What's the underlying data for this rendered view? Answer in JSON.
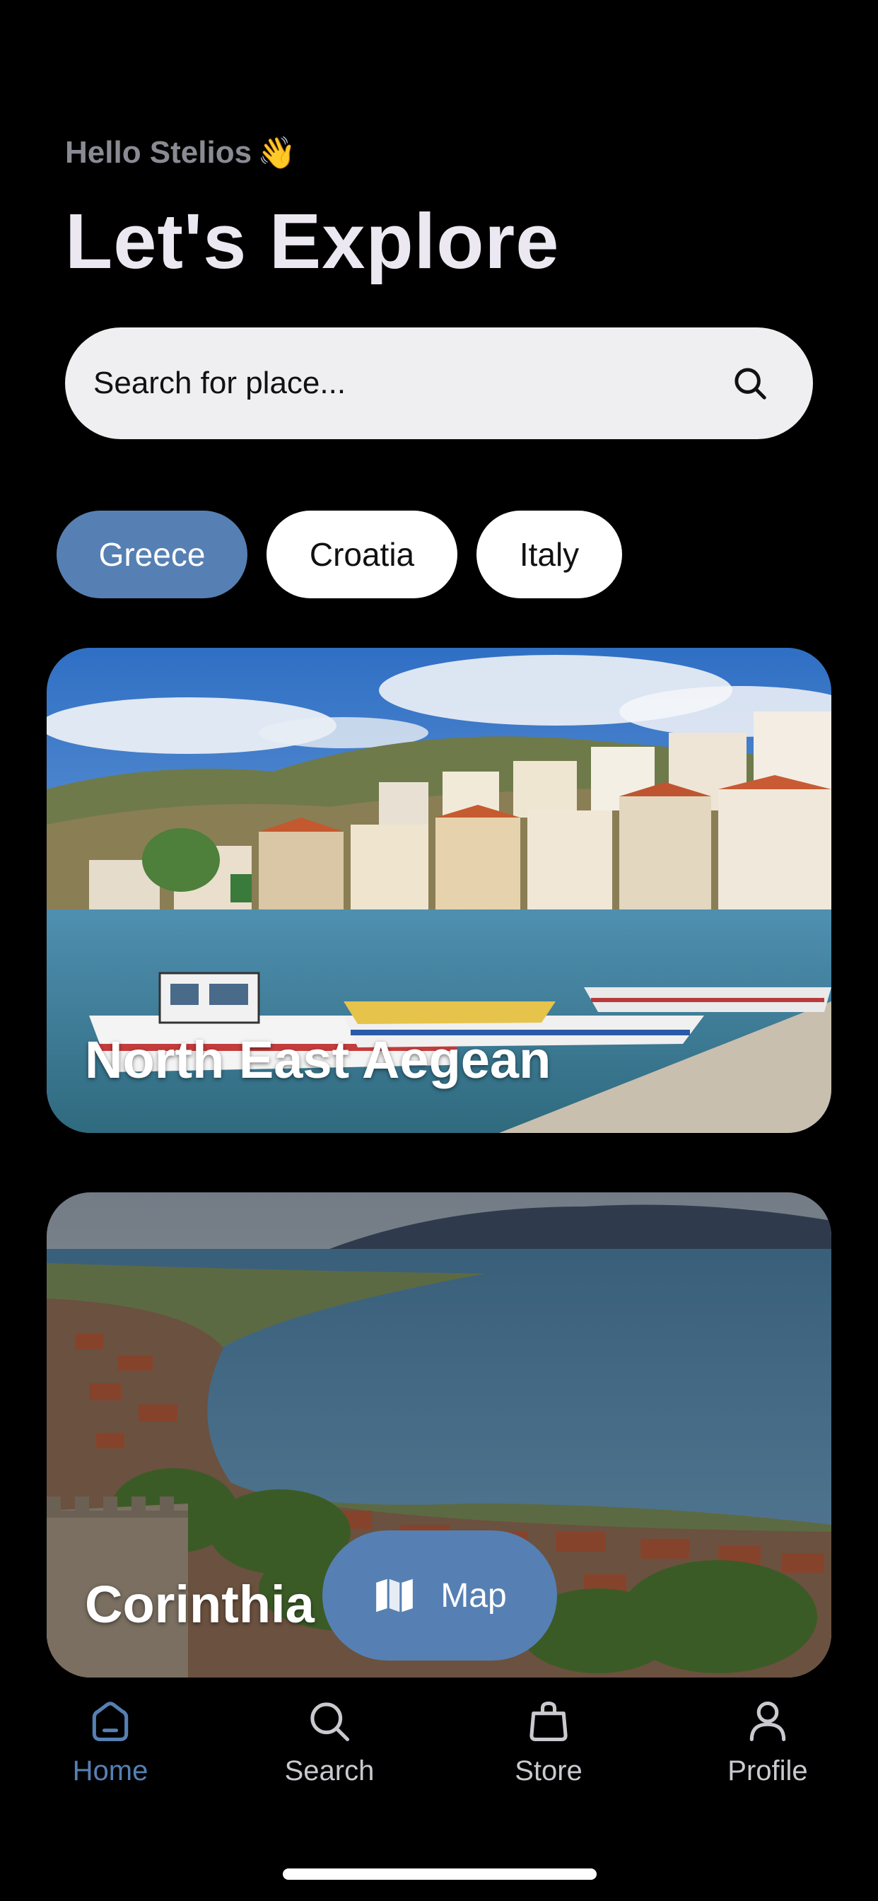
{
  "header": {
    "greeting": "Hello Stelios",
    "wave_emoji": "👋",
    "title": "Let's Explore"
  },
  "search": {
    "placeholder": "Search for place...",
    "icon": "search-icon"
  },
  "filters": [
    {
      "label": "Greece",
      "active": true
    },
    {
      "label": "Croatia",
      "active": false
    },
    {
      "label": "Italy",
      "active": false
    }
  ],
  "cards": [
    {
      "title": "North East Aegean"
    },
    {
      "title": "Corinthia"
    }
  ],
  "map_button": {
    "label": "Map",
    "icon": "map-icon"
  },
  "tabbar": [
    {
      "label": "Home",
      "icon": "home-icon",
      "active": true
    },
    {
      "label": "Search",
      "icon": "search-icon",
      "active": false
    },
    {
      "label": "Store",
      "icon": "shopping-bag-icon",
      "active": false
    },
    {
      "label": "Profile",
      "icon": "person-icon",
      "active": false
    }
  ],
  "colors": {
    "accent": "#5680b3",
    "background": "#000000",
    "search_bg": "#efeff1",
    "title": "#ece8f1"
  }
}
